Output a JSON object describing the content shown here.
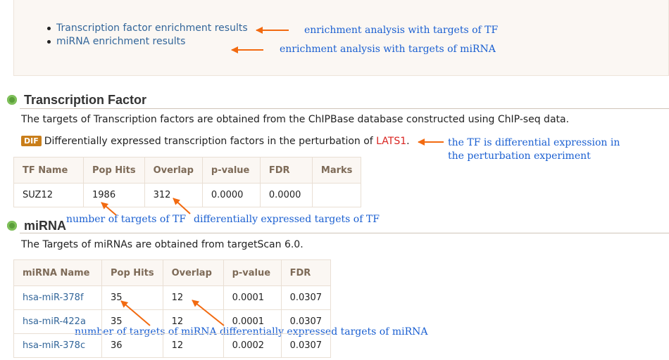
{
  "links": [
    {
      "label": "Transcription factor enrichment results"
    },
    {
      "label": "miRNA enrichment results"
    }
  ],
  "annotations": {
    "tf_link": "enrichment analysis with targets of TF",
    "mirna_link": "enrichment analysis with  targets of miRNA",
    "dif_line1": "the TF is differential expression in",
    "dif_line2": "the perturbation experiment",
    "tf_pop": "number of targets of TF",
    "tf_overlap": "differentially expressed targets of TF",
    "mirna_pop": "number of targets of miRNA",
    "mirna_overlap": "differentially expressed targets of miRNA"
  },
  "tf": {
    "heading": "Transcription Factor",
    "description": "The targets of Transcription factors are obtained from the ChIPBase database constructed using ChIP-seq data.",
    "badge": "DIF",
    "dif_text": "Differentially expressed transcription factors in the perturbation of ",
    "dif_gene": "LATS1",
    "dif_end": ".",
    "columns": [
      "TF Name",
      "Pop Hits",
      "Overlap",
      "p-value",
      "FDR",
      "Marks"
    ],
    "rows": [
      [
        "SUZ12",
        "1986",
        "312",
        "0.0000",
        "0.0000",
        ""
      ]
    ]
  },
  "mirna": {
    "heading": "miRNA",
    "description": "The Targets of miRNAs are obtained from targetScan 6.0.",
    "columns": [
      "miRNA Name",
      "Pop Hits",
      "Overlap",
      "p-value",
      "FDR"
    ],
    "rows": [
      [
        "hsa-miR-378f",
        "35",
        "12",
        "0.0001",
        "0.0307"
      ],
      [
        "hsa-miR-422a",
        "35",
        "12",
        "0.0001",
        "0.0307"
      ],
      [
        "hsa-miR-378c",
        "36",
        "12",
        "0.0002",
        "0.0307"
      ]
    ]
  },
  "colors": {
    "link": "#33669a",
    "annotation": "#1a5fd1",
    "arrow": "#f26a10",
    "badge": "#c97e1a",
    "gene": "#d9231f"
  }
}
